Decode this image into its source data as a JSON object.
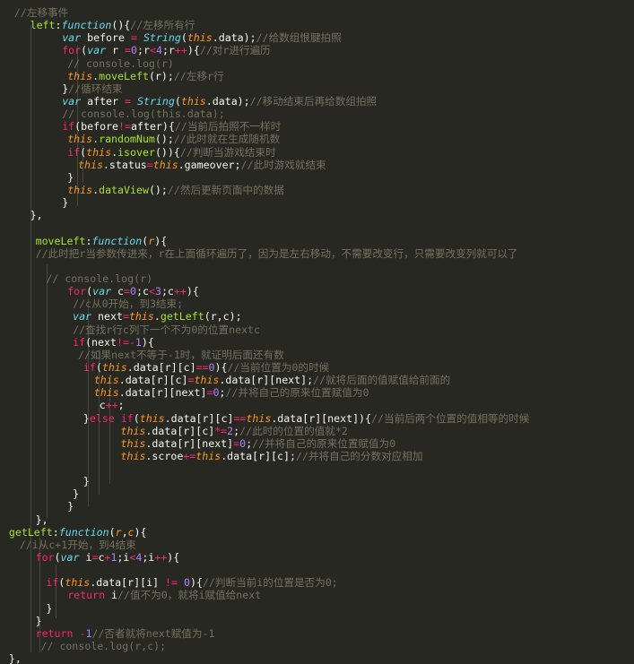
{
  "lines": [
    {
      "indent": 2,
      "tokens": [
        {
          "t": "//左移事件",
          "c": "c"
        }
      ]
    },
    {
      "indent": 5,
      "tokens": [
        {
          "t": "left",
          "c": "f"
        },
        {
          "t": ":",
          "c": "p"
        },
        {
          "t": "function",
          "c": "ti"
        },
        {
          "t": "(){",
          "c": "p"
        },
        {
          "t": "//左移所有行",
          "c": "c"
        }
      ]
    },
    {
      "indent": 11,
      "tokens": [
        {
          "t": "var",
          "c": "s"
        },
        {
          "t": " before ",
          "c": "p"
        },
        {
          "t": "=",
          "c": "k"
        },
        {
          "t": " ",
          "c": "p"
        },
        {
          "t": "String",
          "c": "s"
        },
        {
          "t": "(",
          "c": "p"
        },
        {
          "t": "this",
          "c": "t"
        },
        {
          "t": ".data);",
          "c": "p"
        },
        {
          "t": "//给数组恨腱拍照",
          "c": "c"
        }
      ]
    },
    {
      "indent": 11,
      "tokens": [
        {
          "t": "for",
          "c": "k"
        },
        {
          "t": "(",
          "c": "p"
        },
        {
          "t": "var",
          "c": "s"
        },
        {
          "t": " r ",
          "c": "p"
        },
        {
          "t": "=",
          "c": "k"
        },
        {
          "t": "0",
          "c": "n"
        },
        {
          "t": ";r",
          "c": "p"
        },
        {
          "t": "<",
          "c": "k"
        },
        {
          "t": "4",
          "c": "n"
        },
        {
          "t": ";r",
          "c": "p"
        },
        {
          "t": "++",
          "c": "k"
        },
        {
          "t": "){",
          "c": "p"
        },
        {
          "t": "//对r进行遍历",
          "c": "c"
        }
      ]
    },
    {
      "indent": 12,
      "tokens": [
        {
          "t": "// console.log(r)",
          "c": "c"
        }
      ]
    },
    {
      "indent": 12,
      "tokens": [
        {
          "t": "this",
          "c": "t"
        },
        {
          "t": ".",
          "c": "p"
        },
        {
          "t": "moveLeft",
          "c": "f"
        },
        {
          "t": "(r);",
          "c": "p"
        },
        {
          "t": "//左移r行",
          "c": "c"
        }
      ]
    },
    {
      "indent": 11,
      "tokens": [
        {
          "t": "}",
          "c": "p"
        },
        {
          "t": "//循环结束",
          "c": "c"
        }
      ]
    },
    {
      "indent": 11,
      "tokens": [
        {
          "t": "var",
          "c": "s"
        },
        {
          "t": " after ",
          "c": "p"
        },
        {
          "t": "=",
          "c": "k"
        },
        {
          "t": " ",
          "c": "p"
        },
        {
          "t": "String",
          "c": "s"
        },
        {
          "t": "(",
          "c": "p"
        },
        {
          "t": "this",
          "c": "t"
        },
        {
          "t": ".data);",
          "c": "p"
        },
        {
          "t": "//移动结束后再给数组拍照",
          "c": "c"
        }
      ]
    },
    {
      "indent": 11,
      "tokens": [
        {
          "t": "// console.log(this.data);",
          "c": "c"
        }
      ]
    },
    {
      "indent": 11,
      "tokens": [
        {
          "t": "if",
          "c": "k"
        },
        {
          "t": "(before",
          "c": "p"
        },
        {
          "t": "!=",
          "c": "k"
        },
        {
          "t": "after){",
          "c": "p"
        },
        {
          "t": "//当前后拍照不一样时",
          "c": "c"
        }
      ]
    },
    {
      "indent": 12,
      "tokens": [
        {
          "t": "this",
          "c": "t"
        },
        {
          "t": ".",
          "c": "p"
        },
        {
          "t": "randomNum",
          "c": "f"
        },
        {
          "t": "();",
          "c": "p"
        },
        {
          "t": "//此时就在生成随机数",
          "c": "c"
        }
      ]
    },
    {
      "indent": 12,
      "tokens": [
        {
          "t": "if",
          "c": "k"
        },
        {
          "t": "(",
          "c": "p"
        },
        {
          "t": "this",
          "c": "t"
        },
        {
          "t": ".",
          "c": "p"
        },
        {
          "t": "isover",
          "c": "f"
        },
        {
          "t": "()){",
          "c": "p"
        },
        {
          "t": "//判断当游戏结束时",
          "c": "c"
        }
      ]
    },
    {
      "indent": 14,
      "tokens": [
        {
          "t": "this",
          "c": "t"
        },
        {
          "t": ".status",
          "c": "p"
        },
        {
          "t": "=",
          "c": "k"
        },
        {
          "t": "this",
          "c": "t"
        },
        {
          "t": ".gameover;",
          "c": "p"
        },
        {
          "t": "//此时游戏就结束",
          "c": "c"
        }
      ]
    },
    {
      "indent": 12,
      "tokens": [
        {
          "t": "}",
          "c": "p"
        }
      ]
    },
    {
      "indent": 12,
      "tokens": [
        {
          "t": "this",
          "c": "t"
        },
        {
          "t": ".",
          "c": "p"
        },
        {
          "t": "dataView",
          "c": "f"
        },
        {
          "t": "();",
          "c": "p"
        },
        {
          "t": "//然后更新页面中的数据",
          "c": "c"
        }
      ]
    },
    {
      "indent": 11,
      "tokens": [
        {
          "t": "}",
          "c": "p"
        }
      ]
    },
    {
      "indent": 5,
      "tokens": [
        {
          "t": "},",
          "c": "p"
        }
      ]
    },
    {
      "indent": 0,
      "tokens": []
    },
    {
      "indent": 6,
      "tokens": [
        {
          "t": "moveLeft",
          "c": "f"
        },
        {
          "t": ":",
          "c": "p"
        },
        {
          "t": "function",
          "c": "ti"
        },
        {
          "t": "(",
          "c": "p"
        },
        {
          "t": "r",
          "c": "t"
        },
        {
          "t": "){",
          "c": "p"
        }
      ]
    },
    {
      "indent": 6,
      "tokens": [
        {
          "t": "//此时把r当参数传进来，r在上面循环遍历了，因为是左右移动，不需要改变行，只需要改变列就可以了",
          "c": "c"
        }
      ]
    },
    {
      "indent": 0,
      "tokens": []
    },
    {
      "indent": 8,
      "tokens": [
        {
          "t": "// console.log(r)",
          "c": "c"
        }
      ]
    },
    {
      "indent": 12,
      "tokens": [
        {
          "t": "for",
          "c": "k"
        },
        {
          "t": "(",
          "c": "p"
        },
        {
          "t": "var",
          "c": "s"
        },
        {
          "t": " c",
          "c": "p"
        },
        {
          "t": "=",
          "c": "k"
        },
        {
          "t": "0",
          "c": "n"
        },
        {
          "t": ";c",
          "c": "p"
        },
        {
          "t": "<",
          "c": "k"
        },
        {
          "t": "3",
          "c": "n"
        },
        {
          "t": ";c",
          "c": "p"
        },
        {
          "t": "++",
          "c": "k"
        },
        {
          "t": "){",
          "c": "p"
        }
      ]
    },
    {
      "indent": 13,
      "tokens": [
        {
          "t": "//c从0开始，到3结束;",
          "c": "c"
        }
      ]
    },
    {
      "indent": 13,
      "tokens": [
        {
          "t": "var",
          "c": "s"
        },
        {
          "t": " next",
          "c": "p"
        },
        {
          "t": "=",
          "c": "k"
        },
        {
          "t": "this",
          "c": "t"
        },
        {
          "t": ".",
          "c": "p"
        },
        {
          "t": "getLeft",
          "c": "f"
        },
        {
          "t": "(r,c);",
          "c": "p"
        }
      ]
    },
    {
      "indent": 13,
      "tokens": [
        {
          "t": "//查找r行c列下一个不为0的位置nextc",
          "c": "c"
        }
      ]
    },
    {
      "indent": 13,
      "tokens": [
        {
          "t": "if",
          "c": "k"
        },
        {
          "t": "(next",
          "c": "p"
        },
        {
          "t": "!=-",
          "c": "k"
        },
        {
          "t": "1",
          "c": "n"
        },
        {
          "t": "){",
          "c": "p"
        }
      ]
    },
    {
      "indent": 14,
      "tokens": [
        {
          "t": "//如果next不等于-1时，就证明后面还有数",
          "c": "c"
        }
      ]
    },
    {
      "indent": 15,
      "tokens": [
        {
          "t": "if",
          "c": "k"
        },
        {
          "t": "(",
          "c": "p"
        },
        {
          "t": "this",
          "c": "t"
        },
        {
          "t": ".data[r][c]",
          "c": "p"
        },
        {
          "t": "==",
          "c": "k"
        },
        {
          "t": "0",
          "c": "n"
        },
        {
          "t": "){",
          "c": "p"
        },
        {
          "t": "//当前位置为0的时候",
          "c": "c"
        }
      ]
    },
    {
      "indent": 17,
      "tokens": [
        {
          "t": "this",
          "c": "t"
        },
        {
          "t": ".data[r][c]",
          "c": "p"
        },
        {
          "t": "=",
          "c": "k"
        },
        {
          "t": "this",
          "c": "t"
        },
        {
          "t": ".data[r][next];",
          "c": "p"
        },
        {
          "t": "//就将后面的值赋值给前面的",
          "c": "c"
        }
      ]
    },
    {
      "indent": 17,
      "tokens": [
        {
          "t": "this",
          "c": "t"
        },
        {
          "t": ".data[r][next]",
          "c": "p"
        },
        {
          "t": "=",
          "c": "k"
        },
        {
          "t": "0",
          "c": "n"
        },
        {
          "t": ";",
          "c": "p"
        },
        {
          "t": "//并将自己的原来位置赋值为0",
          "c": "c"
        }
      ]
    },
    {
      "indent": 18,
      "tokens": [
        {
          "t": "c",
          "c": "p"
        },
        {
          "t": "++",
          "c": "k"
        },
        {
          "t": ";",
          "c": "p"
        }
      ]
    },
    {
      "indent": 15,
      "tokens": [
        {
          "t": "}",
          "c": "p"
        },
        {
          "t": "else",
          "c": "k"
        },
        {
          "t": " ",
          "c": "p"
        },
        {
          "t": "if",
          "c": "k"
        },
        {
          "t": "(",
          "c": "p"
        },
        {
          "t": "this",
          "c": "t"
        },
        {
          "t": ".data[r][c]",
          "c": "p"
        },
        {
          "t": "==",
          "c": "k"
        },
        {
          "t": "this",
          "c": "t"
        },
        {
          "t": ".data[r][next]){",
          "c": "p"
        },
        {
          "t": "//当前后两个位置的值相等的时候",
          "c": "c"
        }
      ]
    },
    {
      "indent": 22,
      "tokens": [
        {
          "t": "this",
          "c": "t"
        },
        {
          "t": ".data[r][c]",
          "c": "p"
        },
        {
          "t": "*=",
          "c": "k"
        },
        {
          "t": "2",
          "c": "n"
        },
        {
          "t": ";",
          "c": "p"
        },
        {
          "t": "//此时的位置的值就*2",
          "c": "c"
        }
      ]
    },
    {
      "indent": 22,
      "tokens": [
        {
          "t": "this",
          "c": "t"
        },
        {
          "t": ".data[r][next]",
          "c": "p"
        },
        {
          "t": "=",
          "c": "k"
        },
        {
          "t": "0",
          "c": "n"
        },
        {
          "t": ";",
          "c": "p"
        },
        {
          "t": "//并将自己的原来位置赋值为0",
          "c": "c"
        }
      ]
    },
    {
      "indent": 22,
      "tokens": [
        {
          "t": "this",
          "c": "t"
        },
        {
          "t": ".scroe",
          "c": "p"
        },
        {
          "t": "+=",
          "c": "k"
        },
        {
          "t": "this",
          "c": "t"
        },
        {
          "t": ".data[r][c];",
          "c": "p"
        },
        {
          "t": "//并将自己的分数对应相加",
          "c": "c"
        }
      ]
    },
    {
      "indent": 0,
      "tokens": []
    },
    {
      "indent": 15,
      "tokens": [
        {
          "t": "}",
          "c": "p"
        }
      ]
    },
    {
      "indent": 13,
      "tokens": [
        {
          "t": "}",
          "c": "p"
        }
      ]
    },
    {
      "indent": 12,
      "tokens": [
        {
          "t": "}",
          "c": "p"
        }
      ]
    },
    {
      "indent": 6,
      "tokens": [
        {
          "t": "},",
          "c": "p"
        }
      ]
    },
    {
      "indent": 1,
      "tokens": [
        {
          "t": "getLeft",
          "c": "f"
        },
        {
          "t": ":",
          "c": "p"
        },
        {
          "t": "function",
          "c": "ti"
        },
        {
          "t": "(",
          "c": "p"
        },
        {
          "t": "r",
          "c": "t"
        },
        {
          "t": ",",
          "c": "p"
        },
        {
          "t": "c",
          "c": "t"
        },
        {
          "t": "){",
          "c": "p"
        }
      ]
    },
    {
      "indent": 3,
      "tokens": [
        {
          "t": "//i从c+1开始，到4结束",
          "c": "c"
        }
      ]
    },
    {
      "indent": 6,
      "tokens": [
        {
          "t": "for",
          "c": "k"
        },
        {
          "t": "(",
          "c": "p"
        },
        {
          "t": "var",
          "c": "s"
        },
        {
          "t": " i",
          "c": "p"
        },
        {
          "t": "=",
          "c": "k"
        },
        {
          "t": "c",
          "c": "p"
        },
        {
          "t": "+",
          "c": "k"
        },
        {
          "t": "1",
          "c": "n"
        },
        {
          "t": ";i",
          "c": "p"
        },
        {
          "t": "<",
          "c": "k"
        },
        {
          "t": "4",
          "c": "n"
        },
        {
          "t": ";i",
          "c": "p"
        },
        {
          "t": "++",
          "c": "k"
        },
        {
          "t": "){",
          "c": "p"
        }
      ]
    },
    {
      "indent": 0,
      "tokens": []
    },
    {
      "indent": 8,
      "tokens": [
        {
          "t": "if",
          "c": "k"
        },
        {
          "t": "(",
          "c": "p"
        },
        {
          "t": "this",
          "c": "t"
        },
        {
          "t": ".data[r][i] ",
          "c": "p"
        },
        {
          "t": "!=",
          "c": "k"
        },
        {
          "t": " ",
          "c": "p"
        },
        {
          "t": "0",
          "c": "n"
        },
        {
          "t": "){",
          "c": "p"
        },
        {
          "t": "//判断当前i的位置是否为0;",
          "c": "c"
        }
      ]
    },
    {
      "indent": 12,
      "tokens": [
        {
          "t": "return",
          "c": "k"
        },
        {
          "t": " i",
          "c": "p"
        },
        {
          "t": "//值不为0，就将i赋值给next",
          "c": "c"
        }
      ]
    },
    {
      "indent": 8,
      "tokens": [
        {
          "t": "}",
          "c": "p"
        }
      ]
    },
    {
      "indent": 6,
      "tokens": [
        {
          "t": "}",
          "c": "p"
        }
      ]
    },
    {
      "indent": 6,
      "tokens": [
        {
          "t": "return",
          "c": "k"
        },
        {
          "t": " ",
          "c": "p"
        },
        {
          "t": "-",
          "c": "k"
        },
        {
          "t": "1",
          "c": "n"
        },
        {
          "t": "//否者就将next赋值为-1",
          "c": "c"
        }
      ]
    },
    {
      "indent": 7,
      "tokens": [
        {
          "t": "// console.log(r,c);",
          "c": "c"
        }
      ]
    },
    {
      "indent": 1,
      "tokens": [
        {
          "t": "},",
          "c": "p"
        }
      ]
    }
  ],
  "colors": {
    "background": "#272822",
    "comment": "#75715e",
    "keyword": "#f92672",
    "function_name": "#a6e22e",
    "storage": "#66d9ef",
    "this_param": "#fd971f",
    "number": "#ae81ff",
    "plain": "#f8f8f2",
    "indent_guide": "#45463f"
  }
}
